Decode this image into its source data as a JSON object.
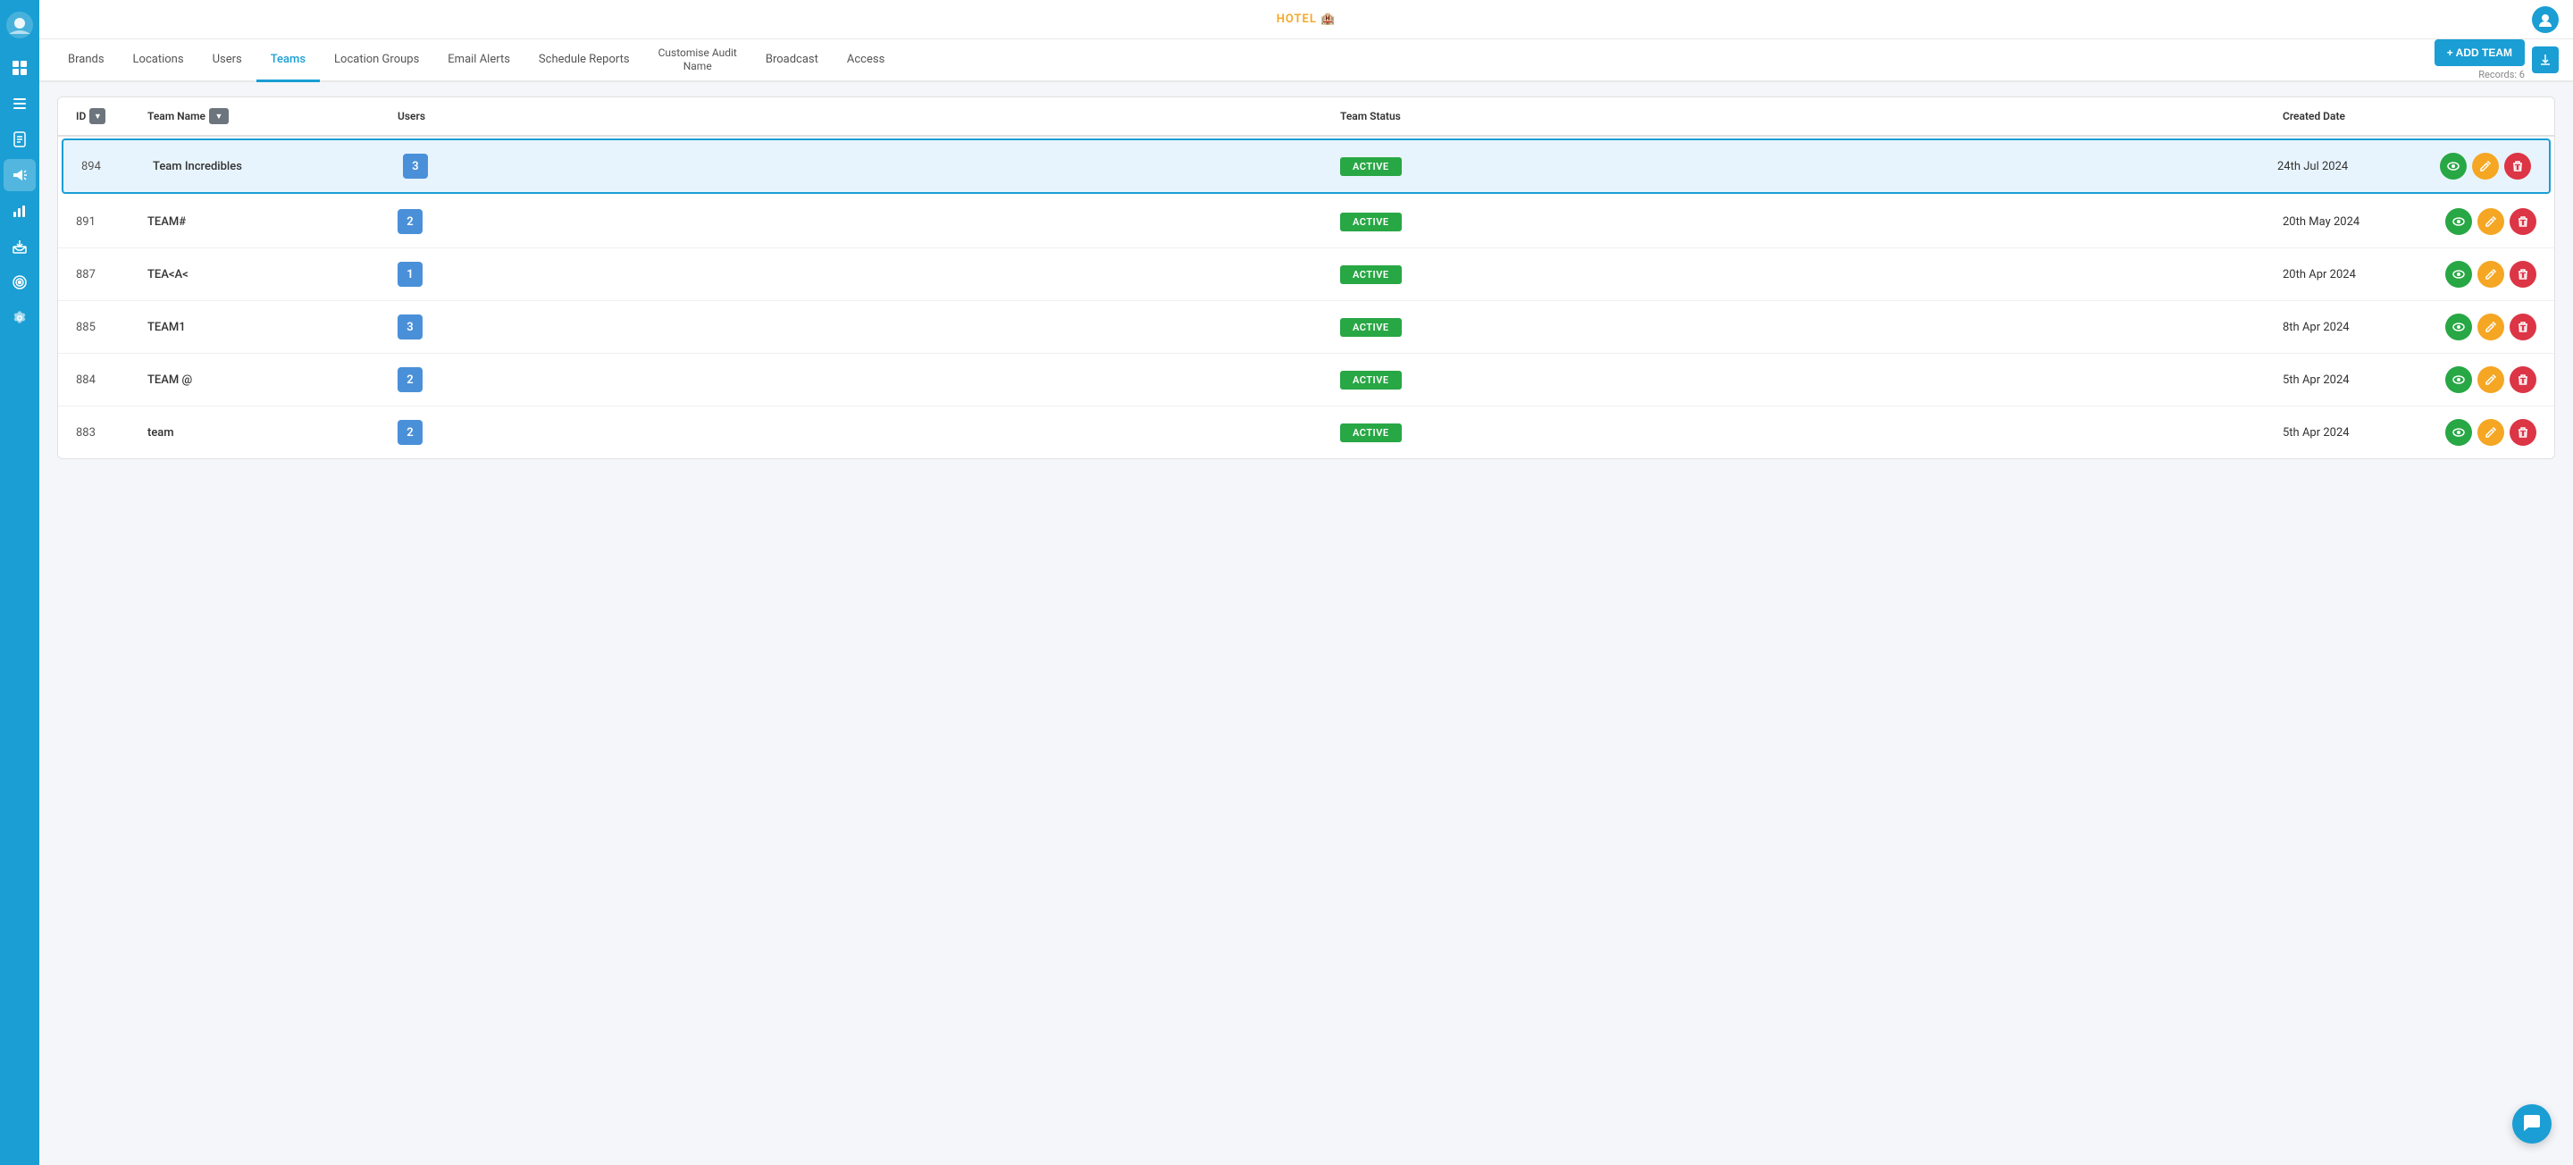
{
  "app": {
    "logo_text": "HOTEL",
    "logo_emoji": "🏨"
  },
  "nav": {
    "tabs": [
      {
        "id": "brands",
        "label": "Brands",
        "active": false
      },
      {
        "id": "locations",
        "label": "Locations",
        "active": false
      },
      {
        "id": "users",
        "label": "Users",
        "active": false
      },
      {
        "id": "teams",
        "label": "Teams",
        "active": true
      },
      {
        "id": "location-groups",
        "label": "Location Groups",
        "active": false
      },
      {
        "id": "email-alerts",
        "label": "Email Alerts",
        "active": false
      },
      {
        "id": "schedule-reports",
        "label": "Schedule Reports",
        "active": false
      },
      {
        "id": "customise-audit-name",
        "label": "Customise Audit Name",
        "active": false
      },
      {
        "id": "broadcast",
        "label": "Broadcast",
        "active": false
      },
      {
        "id": "access",
        "label": "Access",
        "active": false
      }
    ],
    "add_team_label": "+ ADD TEAM",
    "records_label": "Records: 6"
  },
  "table": {
    "columns": [
      {
        "id": "id",
        "label": "ID",
        "sortable": true
      },
      {
        "id": "team_name",
        "label": "Team Name",
        "filterable": true
      },
      {
        "id": "users",
        "label": "Users"
      },
      {
        "id": "team_status",
        "label": "Team Status"
      },
      {
        "id": "created_date",
        "label": "Created Date"
      },
      {
        "id": "actions",
        "label": ""
      }
    ],
    "rows": [
      {
        "id": "894",
        "team_name": "Team Incredibles",
        "users": 3,
        "status": "ACTIVE",
        "created_date": "24th Jul 2024",
        "highlighted": true
      },
      {
        "id": "891",
        "team_name": "TEAM#",
        "users": 2,
        "status": "ACTIVE",
        "created_date": "20th May 2024",
        "highlighted": false
      },
      {
        "id": "887",
        "team_name": "TEA<A<",
        "users": 1,
        "status": "ACTIVE",
        "created_date": "20th Apr 2024",
        "highlighted": false
      },
      {
        "id": "885",
        "team_name": "TEAM1",
        "users": 3,
        "status": "ACTIVE",
        "created_date": "8th Apr 2024",
        "highlighted": false
      },
      {
        "id": "884",
        "team_name": "TEAM @",
        "users": 2,
        "status": "ACTIVE",
        "created_date": "5th Apr 2024",
        "highlighted": false
      },
      {
        "id": "883",
        "team_name": "team",
        "users": 2,
        "status": "ACTIVE",
        "created_date": "5th Apr 2024",
        "highlighted": false
      }
    ]
  },
  "sidebar": {
    "icons": [
      {
        "id": "logo",
        "symbol": "☁"
      },
      {
        "id": "grid",
        "symbol": "⊞"
      },
      {
        "id": "list",
        "symbol": "☰"
      },
      {
        "id": "doc",
        "symbol": "📄"
      },
      {
        "id": "megaphone",
        "symbol": "📢"
      },
      {
        "id": "chart",
        "symbol": "📊"
      },
      {
        "id": "inbox",
        "symbol": "📥"
      },
      {
        "id": "target",
        "symbol": "🎯"
      },
      {
        "id": "gear",
        "symbol": "⚙"
      }
    ]
  },
  "chat_fab": {
    "symbol": "💬"
  },
  "colors": {
    "primary": "#1a9ed4",
    "active_green": "#28a745",
    "edit_orange": "#f5a623",
    "delete_red": "#dc3545",
    "user_badge": "#4a90d9"
  }
}
